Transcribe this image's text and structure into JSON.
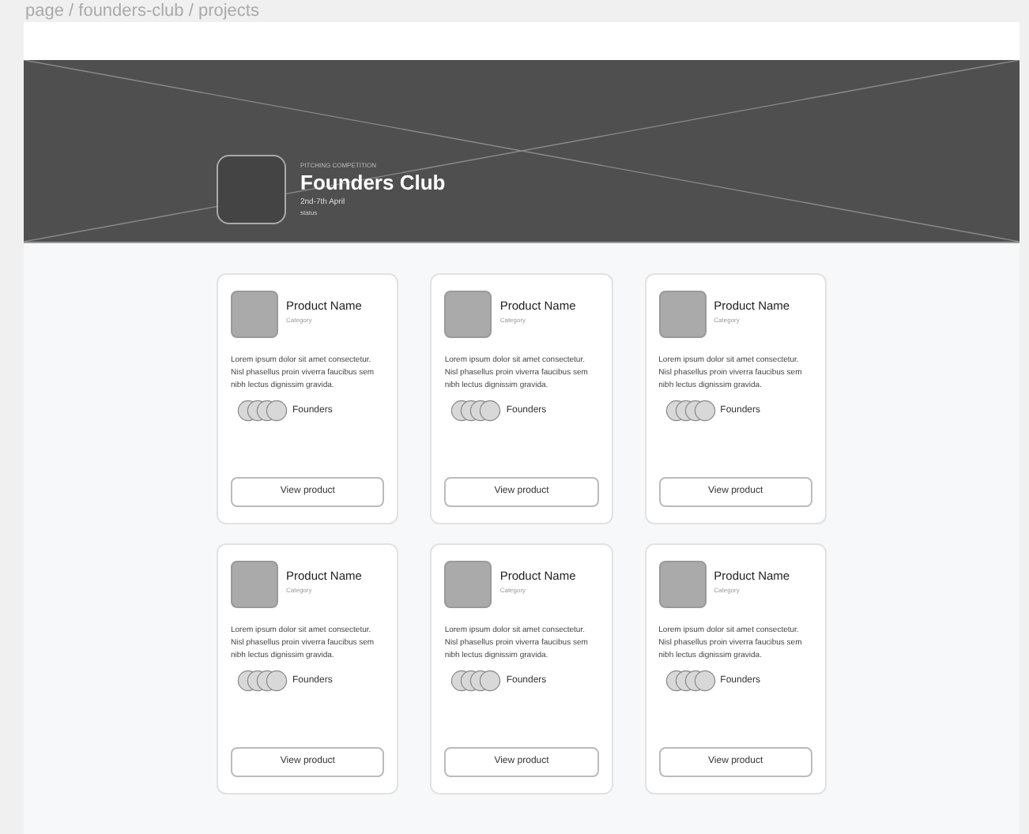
{
  "breadcrumb": "page / founders-club / projects",
  "banner": {
    "eyebrow": "PITCHING COMPETITION",
    "title": "Founders Club",
    "dates": "2nd-7th April",
    "status": "status"
  },
  "products": [
    {
      "name": "Product Name",
      "category": "Category",
      "description": "Lorem ipsum dolor sit amet consectetur. Nisl phasellus proin viverra faucibus sem nibh lectus dignissim gravida.",
      "founders_label": "Founders",
      "button": "View product"
    },
    {
      "name": "Product Name",
      "category": "Category",
      "description": "Lorem ipsum dolor sit amet consectetur. Nisl phasellus proin viverra faucibus sem nibh lectus dignissim gravida.",
      "founders_label": "Founders",
      "button": "View product"
    },
    {
      "name": "Product Name",
      "category": "Category",
      "description": "Lorem ipsum dolor sit amet consectetur. Nisl phasellus proin viverra faucibus sem nibh lectus dignissim gravida.",
      "founders_label": "Founders",
      "button": "View product"
    },
    {
      "name": "Product Name",
      "category": "Category",
      "description": "Lorem ipsum dolor sit amet consectetur. Nisl phasellus proin viverra faucibus sem nibh lectus dignissim gravida.",
      "founders_label": "Founders",
      "button": "View product"
    },
    {
      "name": "Product Name",
      "category": "Category",
      "description": "Lorem ipsum dolor sit amet consectetur. Nisl phasellus proin viverra faucibus sem nibh lectus dignissim gravida.",
      "founders_label": "Founders",
      "button": "View product"
    },
    {
      "name": "Product Name",
      "category": "Category",
      "description": "Lorem ipsum dolor sit amet consectetur. Nisl phasellus proin viverra faucibus sem nibh lectus dignissim gravida.",
      "founders_label": "Founders",
      "button": "View product"
    }
  ]
}
